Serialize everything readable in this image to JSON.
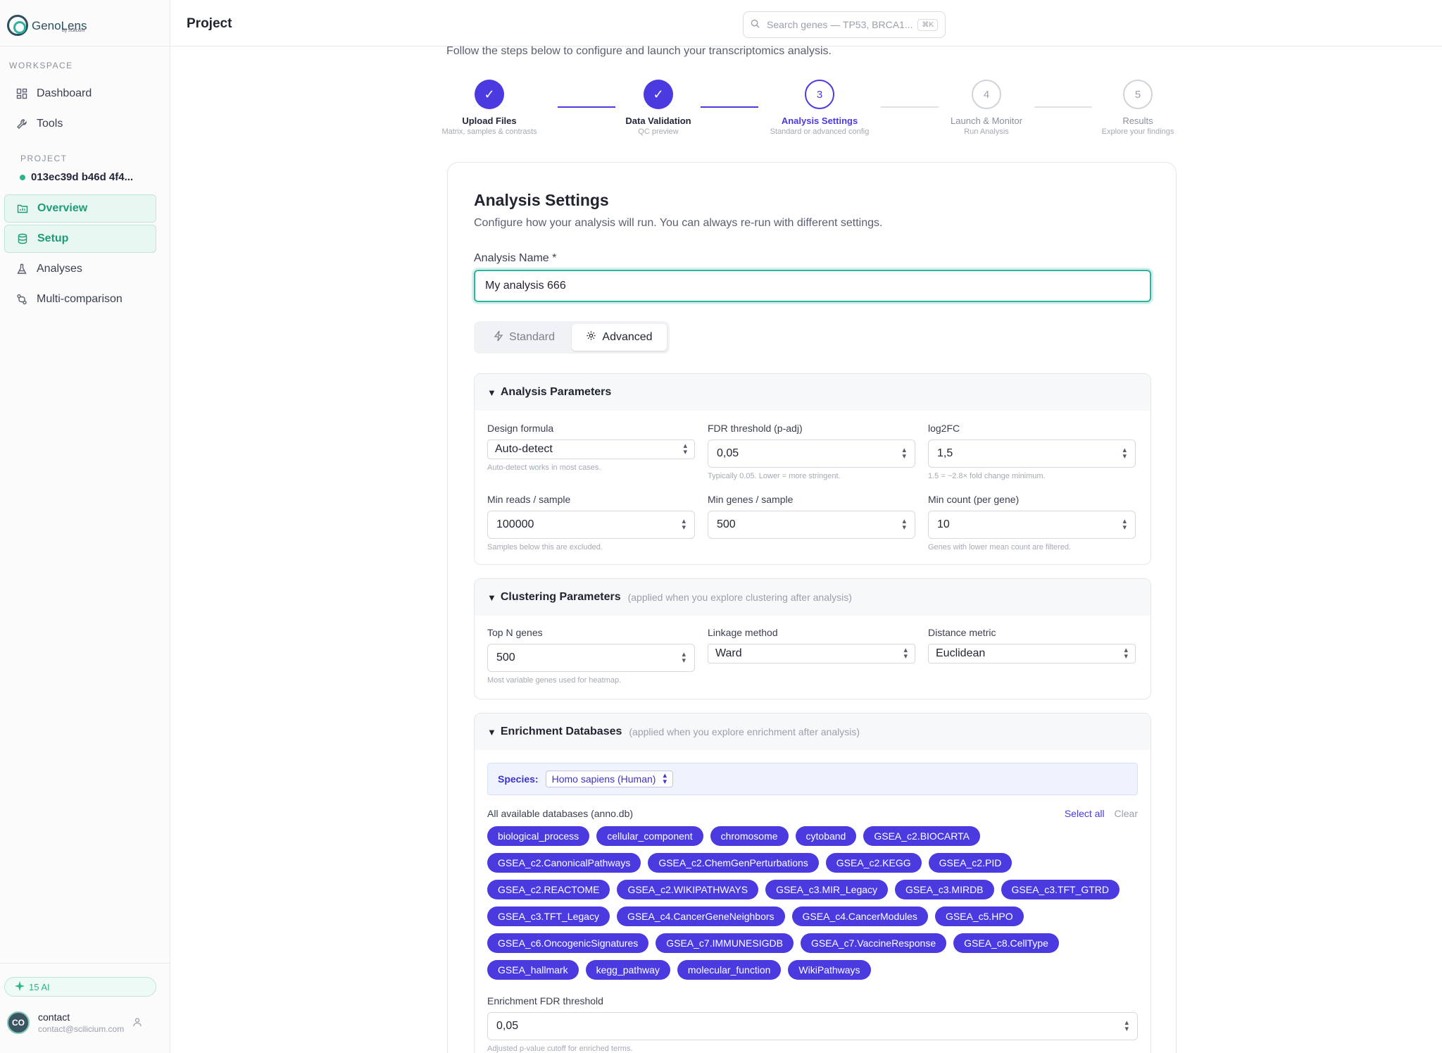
{
  "app": {
    "logo_text": "GenoLens",
    "logo_sub": "By Scilicium"
  },
  "sidebar": {
    "workspace_label": "WORKSPACE",
    "workspace_items": [
      {
        "label": "Dashboard",
        "icon": "dashboard-icon"
      },
      {
        "label": "Tools",
        "icon": "wrench-icon"
      }
    ],
    "project_label": "PROJECT",
    "project_id": "013ec39d b46d 4f4...",
    "project_items": [
      {
        "label": "Overview",
        "icon": "folder-chart-icon",
        "active": true
      },
      {
        "label": "Setup",
        "icon": "database-icon",
        "active": true
      },
      {
        "label": "Analyses",
        "icon": "flask-icon",
        "active": false
      },
      {
        "label": "Multi-comparison",
        "icon": "git-compare-icon",
        "active": false
      }
    ],
    "ai_badge": "15 AI",
    "user": {
      "initials": "CO",
      "name": "contact",
      "email": "contact@scilicium.com"
    }
  },
  "topbar": {
    "title": "Project",
    "search_placeholder": "Search genes — TP53, BRCA1...",
    "search_shortcut": "⌘K"
  },
  "intro": "Follow the steps below to configure and launch your transcriptomics analysis.",
  "steps": [
    {
      "number": "1",
      "title": "Upload Files",
      "subtitle": "Matrix, samples & contrasts",
      "state": "done"
    },
    {
      "number": "2",
      "title": "Data Validation",
      "subtitle": "QC preview",
      "state": "done"
    },
    {
      "number": "3",
      "title": "Analysis Settings",
      "subtitle": "Standard or advanced config",
      "state": "current"
    },
    {
      "number": "4",
      "title": "Launch & Monitor",
      "subtitle": "Run Analysis",
      "state": "todo"
    },
    {
      "number": "5",
      "title": "Results",
      "subtitle": "Explore your findings",
      "state": "todo"
    }
  ],
  "settings": {
    "title": "Analysis Settings",
    "description": "Configure how your analysis will run. You can always re-run with different settings.",
    "name_label": "Analysis Name *",
    "name_value": "My analysis 666",
    "mode_standard": "Standard",
    "mode_advanced": "Advanced",
    "active_mode": "Advanced"
  },
  "analysis_params": {
    "title": "Analysis Parameters",
    "design_formula": {
      "label": "Design formula",
      "value": "Auto-detect",
      "hint": "Auto-detect works in most cases."
    },
    "fdr": {
      "label": "FDR threshold (p-adj)",
      "value": "0,05",
      "hint": "Typically 0.05. Lower = more stringent."
    },
    "log2fc": {
      "label": "log2FC",
      "value": "1,5",
      "hint": "1.5 = ~2.8× fold change minimum."
    },
    "min_reads": {
      "label": "Min reads / sample",
      "value": "100000",
      "hint": "Samples below this are excluded."
    },
    "min_genes": {
      "label": "Min genes / sample",
      "value": "500",
      "hint": ""
    },
    "min_count": {
      "label": "Min count (per gene)",
      "value": "10",
      "hint": "Genes with lower mean count are filtered."
    }
  },
  "clustering": {
    "title": "Clustering Parameters",
    "note": "(applied when you explore clustering after analysis)",
    "top_n": {
      "label": "Top N genes",
      "value": "500",
      "hint": "Most variable genes used for heatmap."
    },
    "linkage": {
      "label": "Linkage method",
      "value": "Ward"
    },
    "distance": {
      "label": "Distance metric",
      "value": "Euclidean"
    }
  },
  "enrichment": {
    "title": "Enrichment Databases",
    "note": "(applied when you explore enrichment after analysis)",
    "species_label": "Species:",
    "species_value": "Homo sapiens (Human)",
    "db_label": "All available databases (anno.db)",
    "select_all": "Select all",
    "clear": "Clear",
    "chip_rows": [
      [
        "biological_process",
        "cellular_component",
        "chromosome",
        "cytoband",
        "GSEA_c2.BIOCARTA"
      ],
      [
        "GSEA_c2.CanonicalPathways",
        "GSEA_c2.ChemGenPerturbations",
        "GSEA_c2.KEGG",
        "GSEA_c2.PID"
      ],
      [
        "GSEA_c2.REACTOME",
        "GSEA_c2.WIKIPATHWAYS",
        "GSEA_c3.MIR_Legacy",
        "GSEA_c3.MIRDB",
        "GSEA_c3.TFT_GTRD"
      ],
      [
        "GSEA_c3.TFT_Legacy",
        "GSEA_c4.CancerGeneNeighbors",
        "GSEA_c4.CancerModules",
        "GSEA_c5.HPO"
      ],
      [
        "GSEA_c6.OncogenicSignatures",
        "GSEA_c7.IMMUNESIGDB",
        "GSEA_c7.VaccineResponse",
        "GSEA_c8.CellType"
      ],
      [
        "GSEA_hallmark",
        "kegg_pathway",
        "molecular_function",
        "WikiPathways"
      ]
    ],
    "fdr": {
      "label": "Enrichment FDR threshold",
      "value": "0,05",
      "hint": "Adjusted p-value cutoff for enriched terms."
    }
  },
  "colors": {
    "accent": "#4a3ae0",
    "teal": "#2fb3a1",
    "green": "#1e9c78"
  }
}
